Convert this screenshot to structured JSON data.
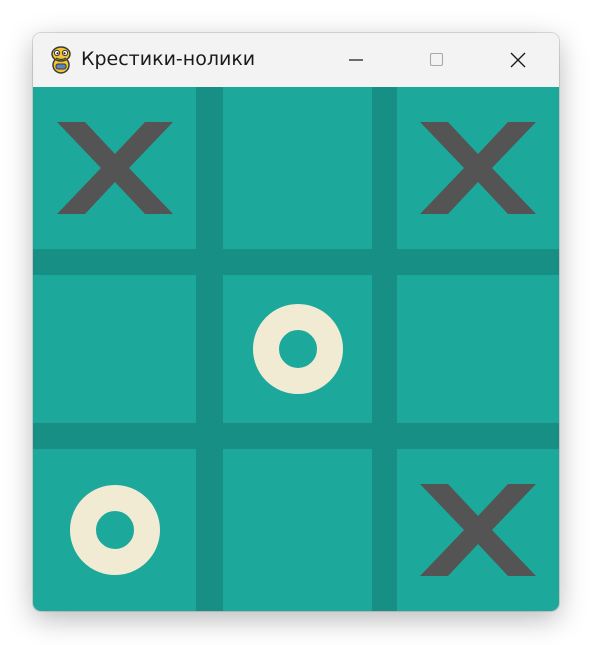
{
  "window": {
    "title": "Крестики-нолики",
    "icon": "python-snake-icon",
    "controls": [
      "minimize-icon",
      "maximize-icon",
      "close-icon"
    ]
  },
  "colors": {
    "board": "#1ca99b",
    "grid_lines": "#178f85",
    "x_mark": "#545454",
    "o_mark": "#f2ebd4"
  },
  "board": {
    "rows": 3,
    "cols": 3,
    "cells": [
      [
        "X",
        "",
        "X"
      ],
      [
        "",
        "O",
        ""
      ],
      [
        "O",
        "",
        "X"
      ]
    ]
  }
}
